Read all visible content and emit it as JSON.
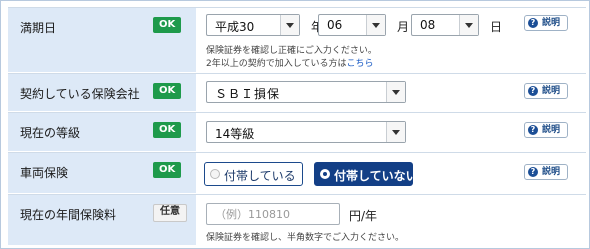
{
  "rows": {
    "expiry": {
      "label": "満期日",
      "status": "OK",
      "era": "平成30",
      "year_unit": "年",
      "month": "06",
      "month_unit": "月",
      "day": "08",
      "day_unit": "日",
      "help": "説明",
      "note1": "保険証券を確認し正確にご入力ください。",
      "note2_prefix": "2年以上の契約で加入している方は",
      "note2_link": "こちら"
    },
    "company": {
      "label": "契約している保険会社",
      "status": "OK",
      "value": "ＳＢＩ損保",
      "help": "説明"
    },
    "grade": {
      "label": "現在の等級",
      "status": "OK",
      "value": "14等級",
      "help": "説明"
    },
    "vehicle": {
      "label": "車両保険",
      "status": "OK",
      "option_with": "付帯している",
      "option_without": "付帯していない",
      "selected": "付帯していない",
      "help": "説明"
    },
    "premium": {
      "label": "現在の年間保険料",
      "status": "任意",
      "placeholder": "（例）110810",
      "unit": "円/年",
      "note": "保険証券を確認し、半角数字でご入力ください。"
    }
  },
  "colors": {
    "label_bg": "#dde9f7",
    "ok_badge": "#1e9a4b",
    "selected_radio": "#133f86"
  }
}
